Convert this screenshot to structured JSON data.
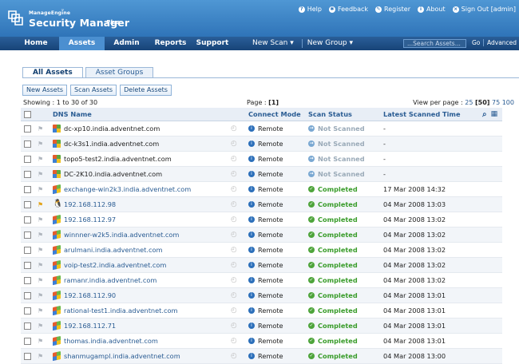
{
  "header": {
    "brand_small": "ManageEngine",
    "brand_tm": "™",
    "brand_main": "Security Manager",
    "brand_plus": "Plus",
    "links": [
      {
        "icon": "help-icon",
        "label": "Help"
      },
      {
        "icon": "feedback-icon",
        "label": "Feedback"
      },
      {
        "icon": "register-icon",
        "label": "Register"
      },
      {
        "icon": "about-icon",
        "label": "About"
      },
      {
        "icon": "signout-icon",
        "label": "Sign Out"
      }
    ],
    "signout_user": "[admin]"
  },
  "nav": {
    "tabs": [
      "Home",
      "Assets",
      "Admin",
      "Reports",
      "Support"
    ],
    "active": "Assets",
    "new_scan": "New Scan ▾",
    "new_group": "New Group ▾",
    "search_placeholder": "...Search Assets...",
    "go": "Go",
    "advanced": "Advanced"
  },
  "subtabs": {
    "all": "All Assets",
    "groups": "Asset Groups"
  },
  "actions": {
    "new": "New Assets",
    "scan": "Scan Assets",
    "delete": "Delete Assets"
  },
  "pager": {
    "showing": "Showing : 1 to 30 of 30",
    "page_label": "Page : ",
    "page_num": "[1]",
    "per_page_label": "View per page : ",
    "opt1": "25",
    "opt2": "[50]",
    "opt3": "75",
    "opt4": "100"
  },
  "columns": {
    "dns": "DNS Name",
    "mode": "Connect Mode",
    "status": "Scan Status",
    "time": "Latest Scanned Time"
  },
  "rows": [
    {
      "dns": "dc-xp10.india.adventnet.com",
      "mode": "Remote",
      "status": "Not Scanned",
      "time": "-"
    },
    {
      "dns": "dc-k3s1.india.adventnet.com",
      "mode": "Remote",
      "status": "Not Scanned",
      "time": "-"
    },
    {
      "dns": "topo5-test2.india.adventnet.com",
      "mode": "Remote",
      "status": "Not Scanned",
      "time": "-"
    },
    {
      "dns": "DC-2K10.india.adventnet.com",
      "mode": "Remote",
      "status": "Not Scanned",
      "time": "-"
    },
    {
      "dns": "exchange-win2k3.india.adventnet.com",
      "mode": "Remote",
      "status": "Completed",
      "time": "17 Mar 2008 14:32"
    },
    {
      "dns": "192.168.112.98",
      "mode": "Remote",
      "status": "Completed",
      "time": "04 Mar 2008 13:03"
    },
    {
      "dns": "192.168.112.97",
      "mode": "Remote",
      "status": "Completed",
      "time": "04 Mar 2008 13:02"
    },
    {
      "dns": "winnner-w2k5.india.adventnet.com",
      "mode": "Remote",
      "status": "Completed",
      "time": "04 Mar 2008 13:02"
    },
    {
      "dns": "arulmani.india.adventnet.com",
      "mode": "Remote",
      "status": "Completed",
      "time": "04 Mar 2008 13:02"
    },
    {
      "dns": "voip-test2.india.adventnet.com",
      "mode": "Remote",
      "status": "Completed",
      "time": "04 Mar 2008 13:02"
    },
    {
      "dns": "ramanr.india.adventnet.com",
      "mode": "Remote",
      "status": "Completed",
      "time": "04 Mar 2008 13:02"
    },
    {
      "dns": "192.168.112.90",
      "mode": "Remote",
      "status": "Completed",
      "time": "04 Mar 2008 13:01"
    },
    {
      "dns": "rational-test1.india.adventnet.com",
      "mode": "Remote",
      "status": "Completed",
      "time": "04 Mar 2008 13:01"
    },
    {
      "dns": "192.168.112.71",
      "mode": "Remote",
      "status": "Completed",
      "time": "04 Mar 2008 13:01"
    },
    {
      "dns": "thomas.india.adventnet.com",
      "mode": "Remote",
      "status": "Completed",
      "time": "04 Mar 2008 13:01"
    },
    {
      "dns": "shanmugampl.india.adventnet.com",
      "mode": "Remote",
      "status": "Completed",
      "time": "04 Mar 2008 13:00"
    }
  ],
  "colors": {
    "header": "#3a82c4",
    "nav": "#1f4f85",
    "link": "#2a5c93",
    "ok": "#3a9c2b"
  }
}
